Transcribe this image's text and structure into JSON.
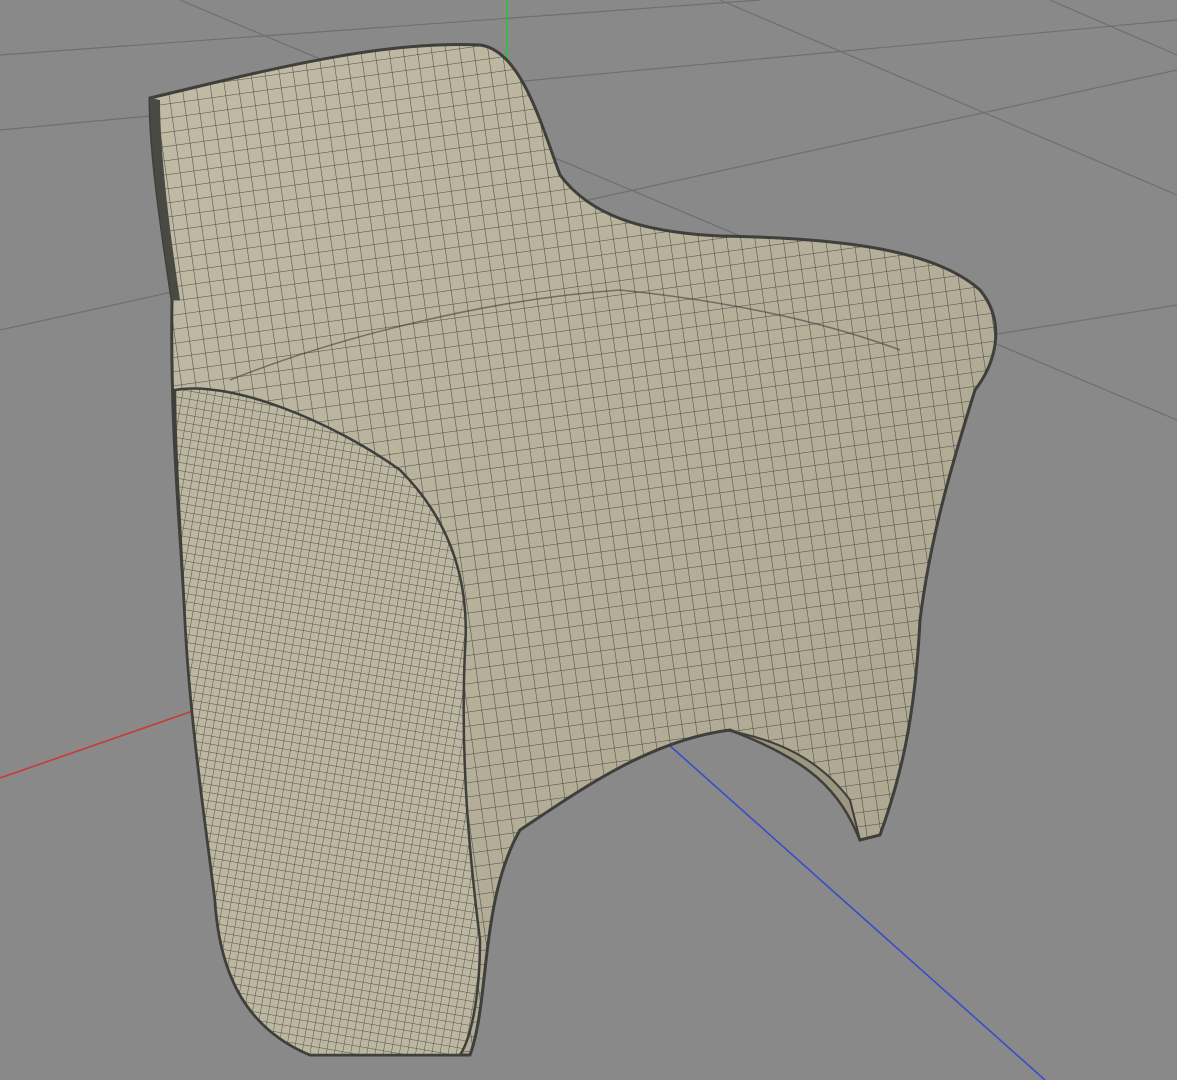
{
  "viewport": {
    "background": "#898989",
    "grid_color": "#6f6f6f",
    "axis_colors": {
      "x": "#c83a3a",
      "y": "#2fbf3a",
      "z": "#3a4cc8"
    }
  },
  "model": {
    "name_hint": "chair-mesh",
    "surface_color": "#b7b19b",
    "wire_color": "#3a3a36",
    "display_mode": "wireframe-on-shaded"
  }
}
